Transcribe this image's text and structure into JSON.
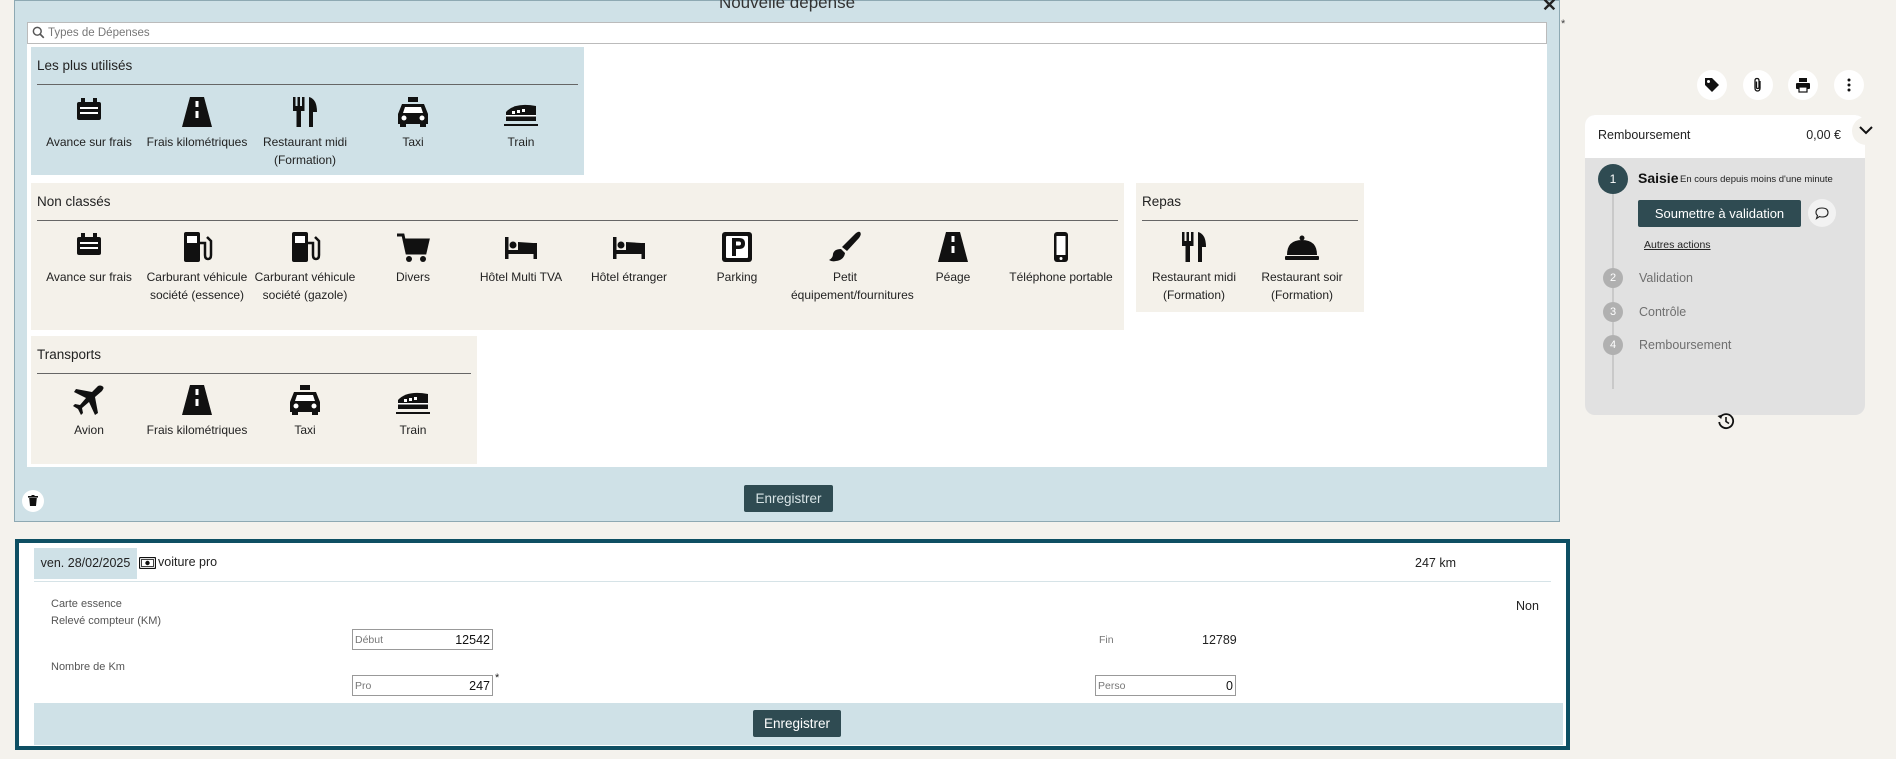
{
  "modal": {
    "title": "Nouvelle dépense",
    "close": "✕",
    "search_placeholder": "Types de Dépenses",
    "save_label": "Enregistrer",
    "required_marker": "*",
    "groups": [
      {
        "title": "Les plus utilisés",
        "items": [
          {
            "label": "Avance sur frais",
            "icon": "cash-advance-icon"
          },
          {
            "label": "Frais kilométriques",
            "icon": "road-icon"
          },
          {
            "label": "Restaurant midi (Formation)",
            "icon": "fork-knife-icon"
          },
          {
            "label": "Taxi",
            "icon": "taxi-icon"
          },
          {
            "label": "Train",
            "icon": "train-icon"
          }
        ]
      },
      {
        "title": "Non classés",
        "items": [
          {
            "label": "Avance sur frais",
            "icon": "cash-advance-icon"
          },
          {
            "label": "Carburant véhicule société (essence)",
            "icon": "fuel-pump-icon"
          },
          {
            "label": "Carburant véhicule société (gazole)",
            "icon": "fuel-pump-icon"
          },
          {
            "label": "Divers",
            "icon": "shopping-cart-icon"
          },
          {
            "label": "Hôtel Multi TVA",
            "icon": "bed-icon"
          },
          {
            "label": "Hôtel étranger",
            "icon": "bed-icon"
          },
          {
            "label": "Parking",
            "icon": "parking-icon"
          },
          {
            "label": "Petit équipement/fournitures",
            "icon": "paint-brush-icon"
          },
          {
            "label": "Péage",
            "icon": "road-icon"
          },
          {
            "label": "Téléphone portable",
            "icon": "mobile-phone-icon"
          }
        ]
      },
      {
        "title": "Repas",
        "items": [
          {
            "label": "Restaurant midi (Formation)",
            "icon": "fork-knife-icon"
          },
          {
            "label": "Restaurant soir (Formation)",
            "icon": "cloche-icon"
          }
        ]
      },
      {
        "title": "Transports",
        "items": [
          {
            "label": "Avion",
            "icon": "plane-icon"
          },
          {
            "label": "Frais kilométriques",
            "icon": "road-icon"
          },
          {
            "label": "Taxi",
            "icon": "taxi-icon"
          },
          {
            "label": "Train",
            "icon": "train-icon"
          }
        ]
      }
    ]
  },
  "reimbursement": {
    "title": "Remboursement",
    "amount": "0,00 €",
    "steps": [
      {
        "number": "1",
        "label": "Saisie",
        "status": "En cours depuis moins d'une minute"
      },
      {
        "number": "2",
        "label": "Validation"
      },
      {
        "number": "3",
        "label": "Contrôle"
      },
      {
        "number": "4",
        "label": "Remboursement"
      }
    ],
    "submit_label": "Soumettre à validation",
    "other_actions": "Autres actions"
  },
  "toolbar_icons": [
    "tag-icon",
    "paperclip-icon",
    "print-icon",
    "more-vertical-icon"
  ],
  "entry": {
    "date": "ven. 28/02/2025",
    "label": "voiture pro",
    "km_total": "247 km",
    "fuel_card_label": "Carte essence",
    "fuel_card_value": "Non",
    "odometer_label": "Relevé compteur (KM)",
    "start_placeholder": "Début",
    "start_value": "12542",
    "end_label": "Fin",
    "end_value": "12789",
    "km_label": "Nombre de Km",
    "pro_placeholder": "Pro",
    "pro_value": "247",
    "pro_required": "*",
    "perso_placeholder": "Perso",
    "perso_value": "0",
    "save_label": "Enregistrer"
  },
  "colors": {
    "dark_teal": "#2f4b52",
    "panel_blue": "#cfe1e7",
    "border_blue": "#0e4f63",
    "beige": "#f4f1ea"
  }
}
